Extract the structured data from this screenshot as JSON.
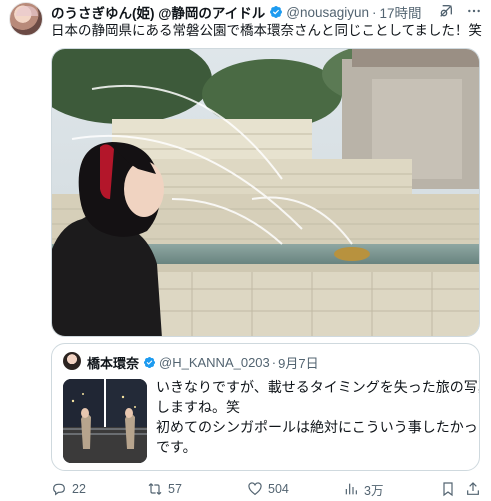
{
  "tweet": {
    "display_name": "のうさぎゆん(姫) @静岡のアイドル",
    "handle": "@nousagiyun",
    "dot": "·",
    "time": "17時間",
    "text": "日本の静岡県にある常磐公園で橋本環奈さんと同じことしてました！笑"
  },
  "quote": {
    "display_name": "橋本環奈",
    "handle": "@H_KANNA_0203",
    "dot": "·",
    "date": "9月7日",
    "text_lines": [
      "いきなりですが、載せるタイミングを失った旅の写真出",
      "しますね。笑",
      "初めてのシンガポールは絶対にこういう事したかったん",
      "です。"
    ]
  },
  "actions": {
    "replies": "22",
    "retweets": "57",
    "likes": "504",
    "views": "3万"
  },
  "colors": {
    "accent": "#1d9bf0",
    "muted": "#536471",
    "border": "#cfd9de"
  },
  "icons": [
    "grok-icon",
    "more-icon",
    "verified-icon",
    "reply-icon",
    "retweet-icon",
    "like-icon",
    "views-icon",
    "bookmark-icon",
    "share-icon"
  ]
}
